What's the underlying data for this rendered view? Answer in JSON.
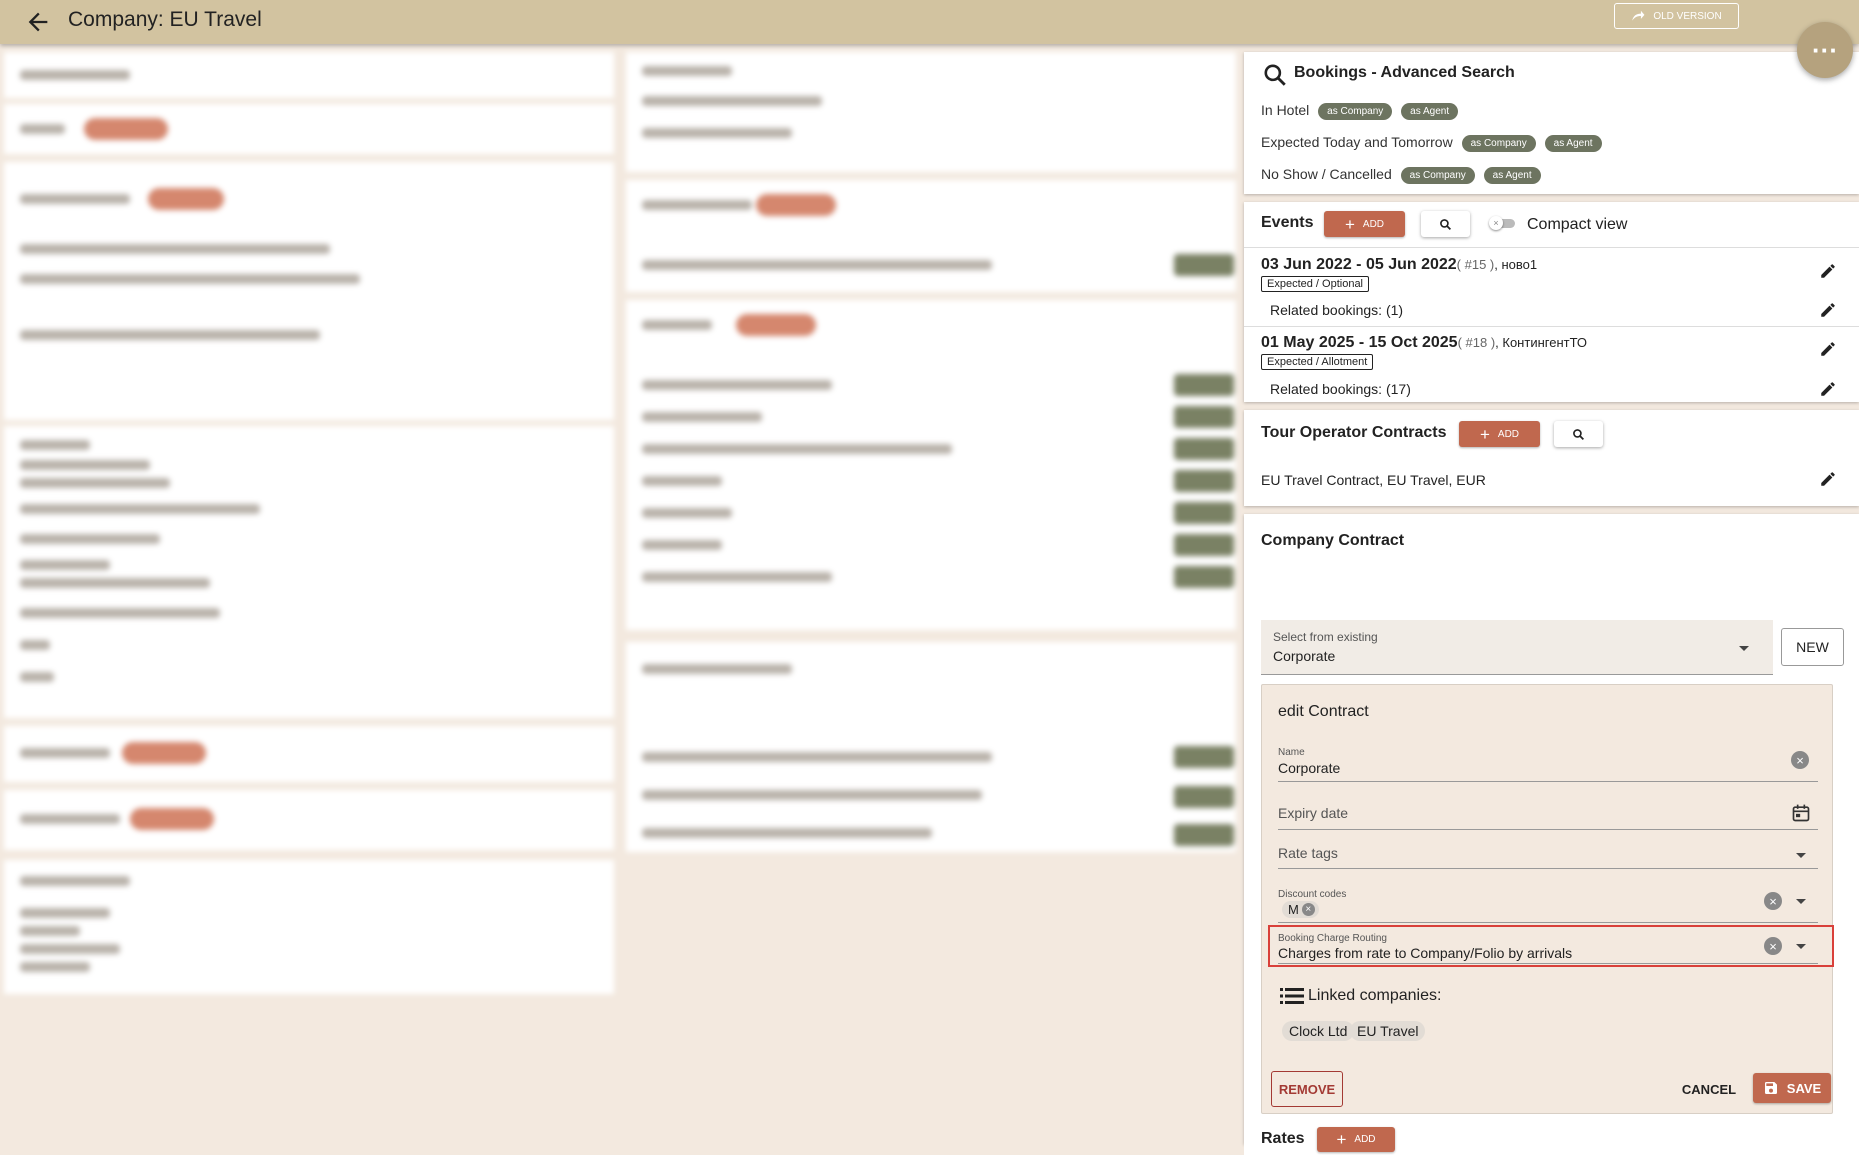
{
  "header": {
    "title": "Company: EU Travel",
    "old_version_label": "OLD VERSION",
    "more_label": "···"
  },
  "bookings_search": {
    "title": "Bookings - Advanced Search",
    "rows": [
      {
        "label": "In Hotel",
        "tags": [
          "as Company",
          "as Agent"
        ]
      },
      {
        "label": "Expected Today and Tomorrow",
        "tags": [
          "as Company",
          "as Agent"
        ]
      },
      {
        "label": "No Show / Cancelled",
        "tags": [
          "as Company",
          "as Agent"
        ]
      }
    ]
  },
  "events": {
    "title": "Events",
    "add_label": "ADD",
    "compact_label": "Compact view",
    "items": [
      {
        "dates": "03 Jun 2022 - 05 Jun 2022",
        "meta": "( #15 )",
        "suffix": ", ново1",
        "status": "Expected / Optional",
        "related": "Related bookings: (1)"
      },
      {
        "dates": "01 May 2025 - 15 Oct 2025",
        "meta": "( #18 )",
        "suffix": ", КонтингентТО",
        "status": "Expected / Allotment",
        "related": "Related bookings: (17)"
      }
    ]
  },
  "tour_operator": {
    "title": "Tour Operator Contracts",
    "add_label": "ADD",
    "item": "EU Travel Contract, EU Travel, EUR"
  },
  "company_contract": {
    "title": "Company Contract",
    "select_label": "Select from existing",
    "select_value": "Corporate",
    "new_label": "NEW",
    "edit": {
      "title": "edit Contract",
      "name_label": "Name",
      "name_value": "Corporate",
      "expiry_placeholder": "Expiry date",
      "rate_tags_placeholder": "Rate tags",
      "discount_label": "Discount codes",
      "discount_chip": "M",
      "routing_label": "Booking Charge Routing",
      "routing_value": "Charges from rate to Company/Folio by arrivals",
      "linked_title": "Linked companies:",
      "linked": [
        "Clock Ltd",
        "EU Travel"
      ],
      "remove_label": "REMOVE",
      "cancel_label": "CANCEL",
      "save_label": "SAVE"
    }
  },
  "rates": {
    "title": "Rates",
    "add_label": "ADD"
  },
  "colors": {
    "accent": "#c0684e",
    "topbar": "#d2c3a0",
    "pill": "#6d7460",
    "highlight": "#d9403a"
  }
}
